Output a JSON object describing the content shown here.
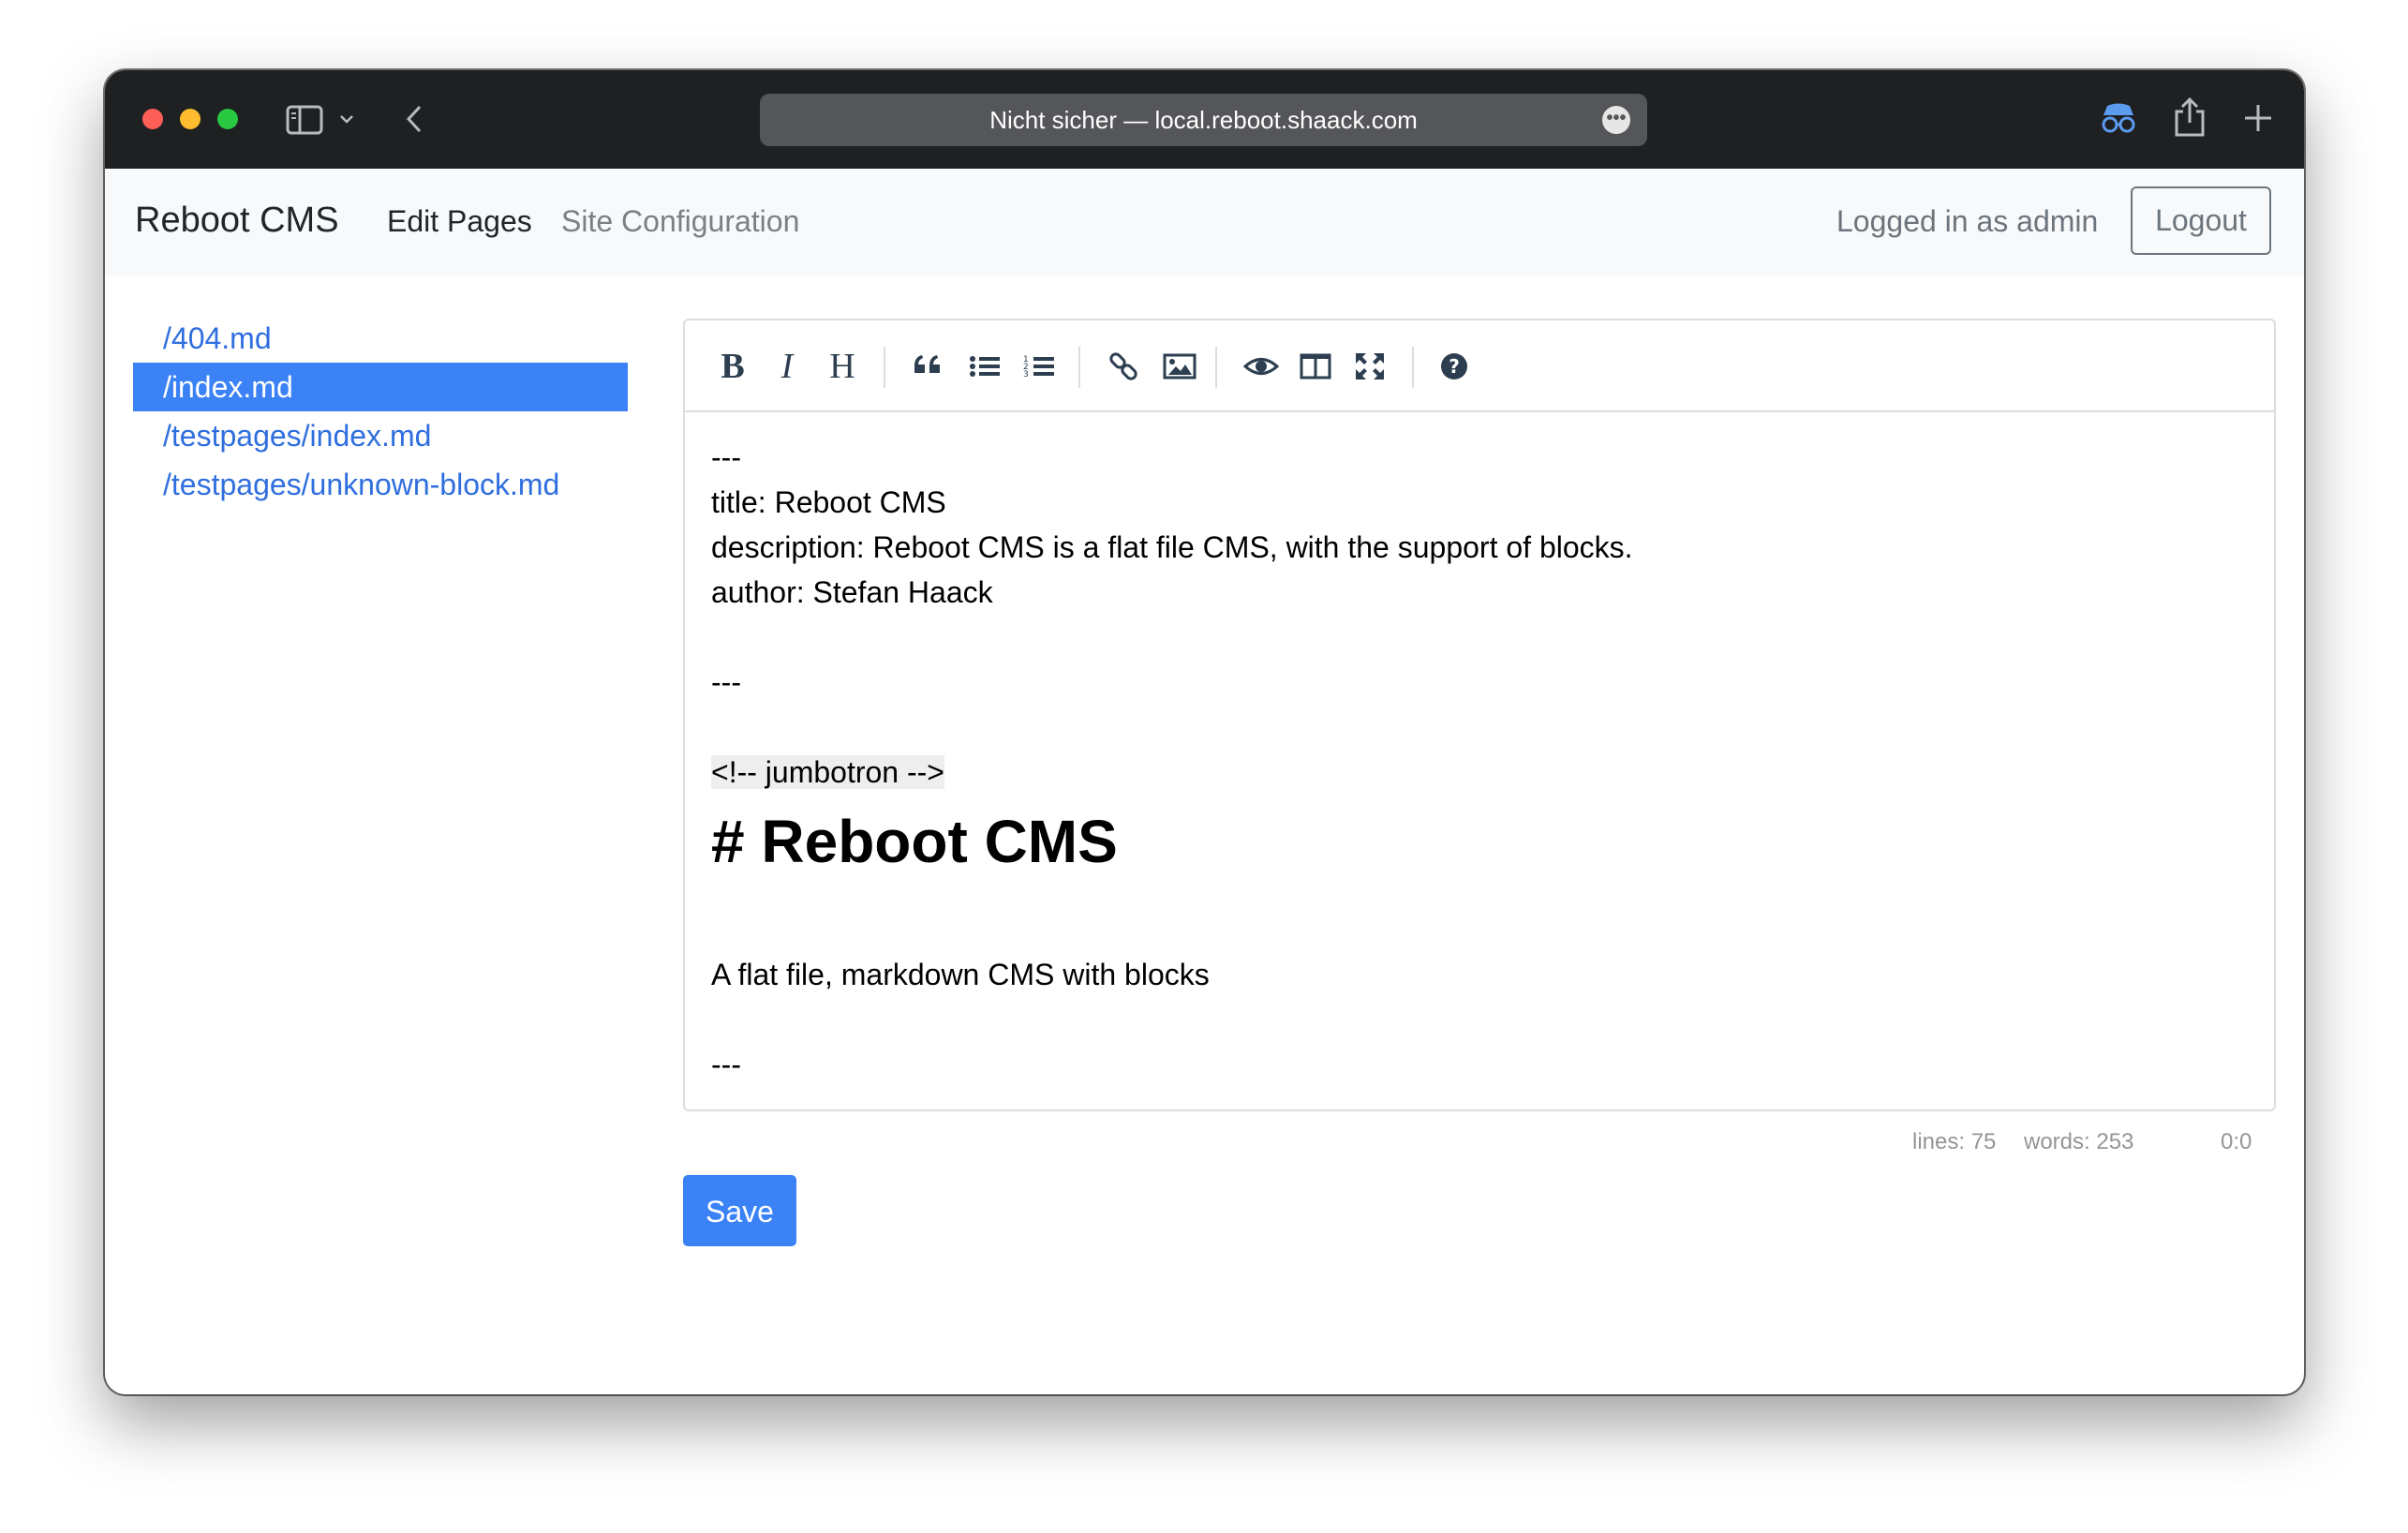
{
  "browser": {
    "url_text": "Nicht sicher — local.reboot.shaack.com",
    "icons": [
      "sidebar-icon",
      "chevron-down-icon",
      "back-icon",
      "more-icon",
      "incognito-icon",
      "share-icon",
      "plus-icon"
    ]
  },
  "navbar": {
    "brand": "Reboot CMS",
    "links": [
      "Edit Pages",
      "Site Configuration"
    ],
    "logged_in": "Logged in as admin",
    "logout": "Logout"
  },
  "sidebar": {
    "items": [
      {
        "label": "/404.md",
        "active": false
      },
      {
        "label": "/index.md",
        "active": true
      },
      {
        "label": "/testpages/index.md",
        "active": false
      },
      {
        "label": "/testpages/unknown-block.md",
        "active": false
      }
    ]
  },
  "toolbar": {
    "bold": "B",
    "italic": "I",
    "heading": "H",
    "icons": [
      "bold-icon",
      "italic-icon",
      "heading-icon",
      "quote-icon",
      "unordered-list-icon",
      "ordered-list-icon",
      "link-icon",
      "image-icon",
      "preview-icon",
      "side-by-side-icon",
      "fullscreen-icon",
      "help-icon"
    ]
  },
  "editor": {
    "lines": [
      "---",
      "title: Reboot CMS",
      "description: Reboot CMS is a flat file CMS, with the support of blocks.",
      "author: Stefan Haack",
      "",
      "---",
      "",
      "<!-- jumbotron -->",
      "# Reboot CMS",
      "",
      "A flat file, markdown CMS with blocks",
      "",
      "---"
    ]
  },
  "status": {
    "lines": "lines: 75",
    "words": "words: 253",
    "cursor": "0:0"
  },
  "save_label": "Save",
  "colors": {
    "primary": "#3b82f6",
    "link": "#2f6ede",
    "titlebar": "#1e2022"
  }
}
